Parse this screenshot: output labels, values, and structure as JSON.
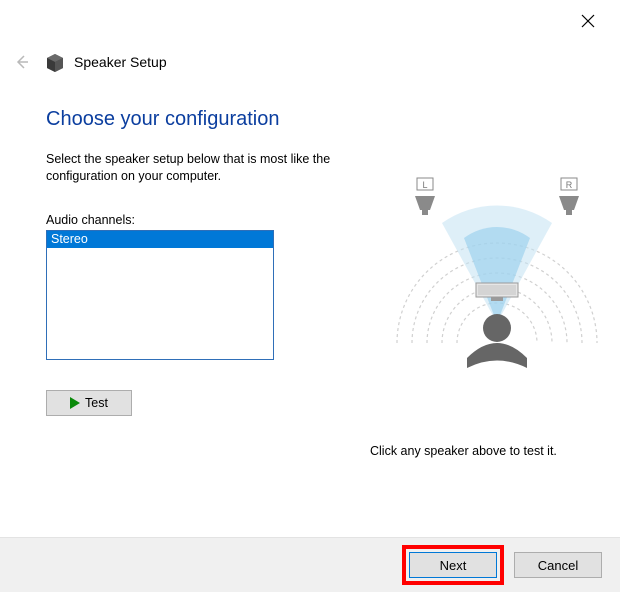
{
  "window": {
    "title": "Speaker Setup"
  },
  "page": {
    "heading": "Choose your configuration",
    "instruction": "Select the speaker setup below that is most like the configuration on your computer.",
    "channels_label": "Audio channels:",
    "channels": {
      "options": [
        "Stereo"
      ],
      "selected": "Stereo"
    },
    "test_label": "Test",
    "diagram": {
      "left_speaker": "L",
      "right_speaker": "R"
    },
    "hint": "Click any speaker above to test it."
  },
  "footer": {
    "next_label": "Next",
    "cancel_label": "Cancel"
  }
}
